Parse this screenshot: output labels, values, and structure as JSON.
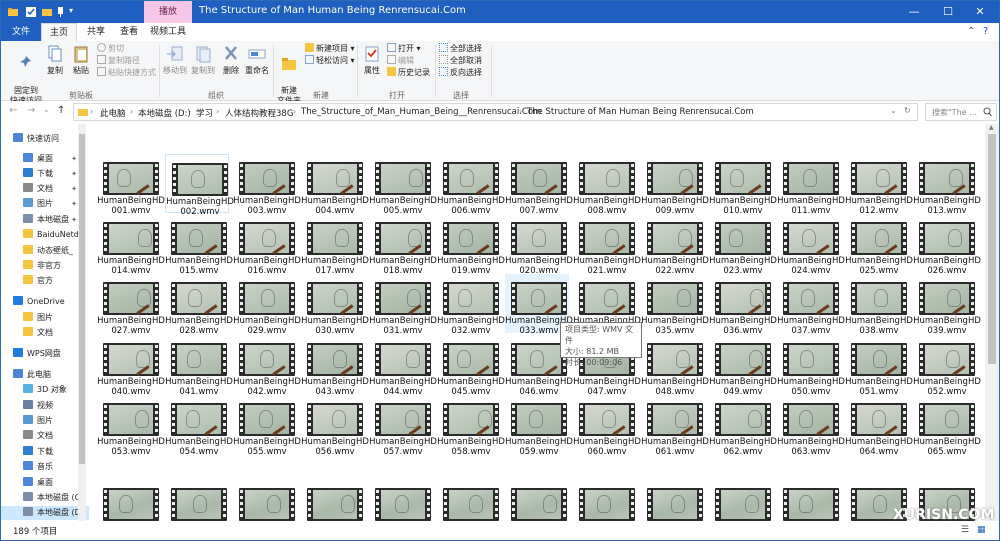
{
  "window": {
    "title": "The Structure of Man Human Being  Renrensucai.Com",
    "context_tab": "播放",
    "controls": {
      "minimize": "—",
      "maximize": "☐",
      "close": "✕"
    },
    "accent": "#1f5fbf"
  },
  "ribbon_tabs": {
    "file": "文件",
    "home": "主页",
    "share": "共享",
    "view": "查看",
    "video_tools": "视频工具"
  },
  "ribbon": {
    "clipboard": {
      "pin_quick": "固定到\n快速访问",
      "copy": "复制",
      "paste": "粘贴",
      "cut": "剪切",
      "copy_path": "复制路径",
      "paste_shortcut": "粘贴快捷方式",
      "label": "剪贴板"
    },
    "organize": {
      "move_to": "移动到",
      "copy_to": "复制到",
      "delete": "删除",
      "rename": "重命名",
      "label": "组织"
    },
    "new": {
      "new_folder": "新建\n文件夹",
      "new_item": "新建项目 ▾",
      "easy_access": "轻松访问 ▾",
      "label": "新建"
    },
    "open": {
      "properties": "属性",
      "open": "打开 ▾",
      "edit": "编辑",
      "history": "历史记录",
      "label": "打开"
    },
    "select": {
      "select_all": "全部选择",
      "select_none": "全部取消",
      "invert": "反向选择",
      "label": "选择"
    }
  },
  "address": {
    "crumbs": [
      "此电脑",
      "本地磁盘 (D:)",
      "学习",
      "人体结构教程38G",
      "The_Structure_of_Man_Human_Being__Renrensucai.Com",
      "The Structure of Man Human Being  Renrensucai.Com"
    ],
    "search_placeholder": "搜索\"The ..."
  },
  "nav": [
    {
      "label": "快速访问",
      "icon": "star-icon",
      "pinned": false
    },
    {
      "label": "桌面",
      "icon": "desktop-icon",
      "pinned": true
    },
    {
      "label": "下载",
      "icon": "download-icon",
      "pinned": true
    },
    {
      "label": "文档",
      "icon": "document-icon",
      "pinned": true
    },
    {
      "label": "图片",
      "icon": "picture-icon",
      "pinned": true
    },
    {
      "label": "本地磁盘",
      "icon": "drive-icon",
      "pinned": true
    },
    {
      "label": "BaiduNetd",
      "icon": "folder-icon",
      "pinned": false
    },
    {
      "label": "动态壁纸_",
      "icon": "folder-icon",
      "pinned": false
    },
    {
      "label": "非官方",
      "icon": "folder-icon",
      "pinned": false
    },
    {
      "label": "官方",
      "icon": "folder-icon",
      "pinned": false
    },
    {
      "label": "OneDrive",
      "icon": "cloud-icon",
      "pinned": false
    },
    {
      "label": "图片",
      "icon": "folder-icon",
      "pinned": false
    },
    {
      "label": "文档",
      "icon": "folder-icon",
      "pinned": false
    },
    {
      "label": "WPS网盘",
      "icon": "cloud-icon",
      "pinned": false
    },
    {
      "label": "此电脑",
      "icon": "computer-icon",
      "pinned": false
    },
    {
      "label": "3D 对象",
      "icon": "cube-icon",
      "pinned": false
    },
    {
      "label": "视频",
      "icon": "video-icon",
      "pinned": false
    },
    {
      "label": "图片",
      "icon": "picture-icon",
      "pinned": false
    },
    {
      "label": "文档",
      "icon": "document-icon",
      "pinned": false
    },
    {
      "label": "下载",
      "icon": "download-icon",
      "pinned": false
    },
    {
      "label": "音乐",
      "icon": "music-icon",
      "pinned": false
    },
    {
      "label": "桌面",
      "icon": "desktop-icon",
      "pinned": false
    },
    {
      "label": "本地磁盘 (C",
      "icon": "drive-icon",
      "pinned": false
    },
    {
      "label": "本地磁盘 (D",
      "icon": "drive-icon",
      "pinned": false
    }
  ],
  "files": {
    "prefix": "HumanBeingHD",
    "names": [
      "001",
      "002",
      "003",
      "004",
      "005",
      "006",
      "007",
      "008",
      "009",
      "010",
      "011",
      "012",
      "013",
      "014",
      "015",
      "016",
      "017",
      "018",
      "019",
      "020",
      "021",
      "022",
      "023",
      "024",
      "025",
      "026",
      "027",
      "028",
      "029",
      "030",
      "031",
      "032",
      "033",
      "034",
      "035",
      "036",
      "037",
      "038",
      "039",
      "040",
      "041",
      "042",
      "043",
      "044",
      "045",
      "046",
      "047",
      "048",
      "049",
      "050",
      "051",
      "052",
      "053",
      "054",
      "055",
      "056",
      "057",
      "058",
      "059",
      "060",
      "061",
      "062",
      "063",
      "064",
      "065"
    ],
    "extension": ".wmv",
    "partial_last_row_count": 13
  },
  "tooltip": {
    "type": "项目类型: WMV 文件",
    "size": "大小: 81.2 MB",
    "duration": "时长: 00:09:06"
  },
  "status": {
    "count": "189 个项目"
  },
  "watermark": "XURISN.COM"
}
